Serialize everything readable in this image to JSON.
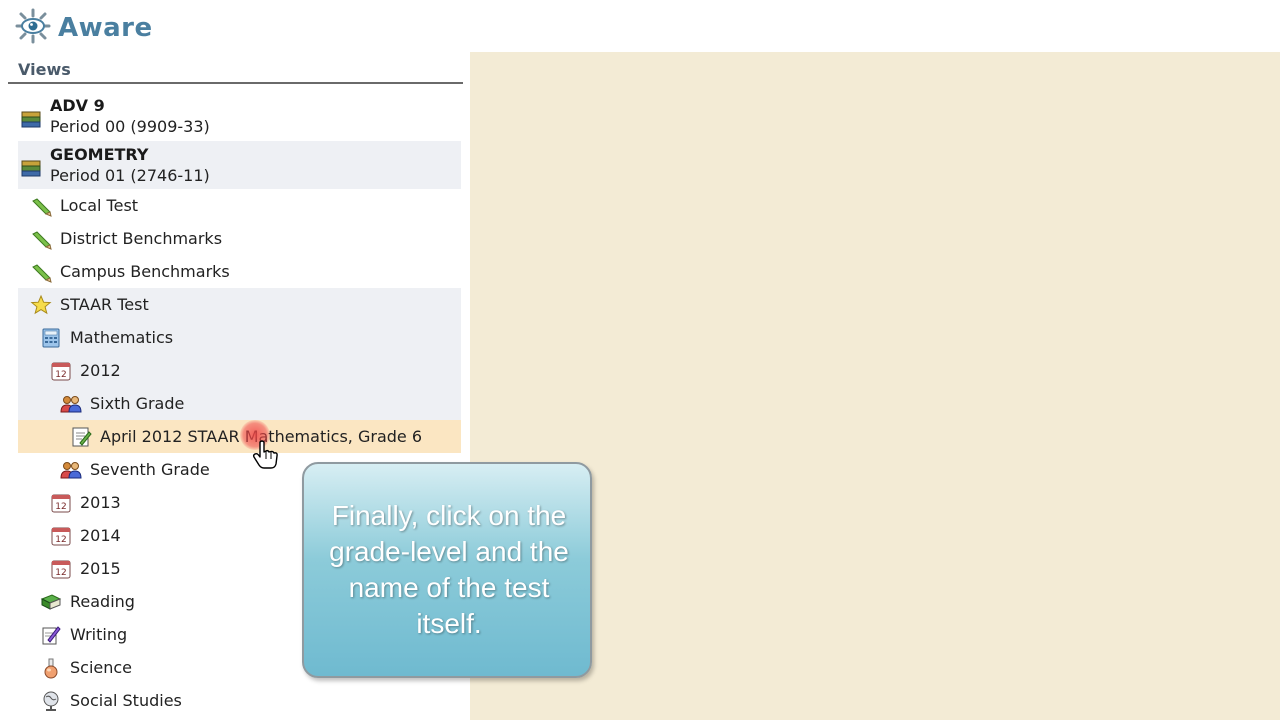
{
  "app": {
    "name": "Aware"
  },
  "sidebar": {
    "title": "Views",
    "items": [
      {
        "bold": "ADV 9",
        "sub": "Period 00 (9909-33)",
        "icon": "stack-books-icon"
      },
      {
        "bold": "GEOMETRY",
        "sub": "Period 01 (2746-11)",
        "icon": "stack-books-icon"
      },
      {
        "label": "Local Test",
        "icon": "pencil-icon"
      },
      {
        "label": "District Benchmarks",
        "icon": "pencil-icon"
      },
      {
        "label": "Campus Benchmarks",
        "icon": "pencil-icon"
      },
      {
        "label": "STAAR Test",
        "icon": "star-icon"
      },
      {
        "label": "Mathematics",
        "icon": "calculator-icon"
      },
      {
        "label": "2012",
        "icon": "calendar-icon"
      },
      {
        "label": "Sixth Grade",
        "icon": "users-icon"
      },
      {
        "label": "April 2012 STAAR Mathematics, Grade 6",
        "icon": "document-icon"
      },
      {
        "label": "Seventh Grade",
        "icon": "users-icon"
      },
      {
        "label": "2013",
        "icon": "calendar-icon"
      },
      {
        "label": "2014",
        "icon": "calendar-icon"
      },
      {
        "label": "2015",
        "icon": "calendar-icon"
      },
      {
        "label": "Reading",
        "icon": "book-icon"
      },
      {
        "label": "Writing",
        "icon": "pen-paper-icon"
      },
      {
        "label": "Science",
        "icon": "flask-icon"
      },
      {
        "label": "Social Studies",
        "icon": "globe-icon"
      }
    ]
  },
  "callout": {
    "text": "Finally, click on the grade-level and the name of the test itself."
  },
  "colors": {
    "content_bg": "#f3ebd5",
    "selected_row": "#fbe6c2",
    "brand": "#4a7fa0"
  }
}
